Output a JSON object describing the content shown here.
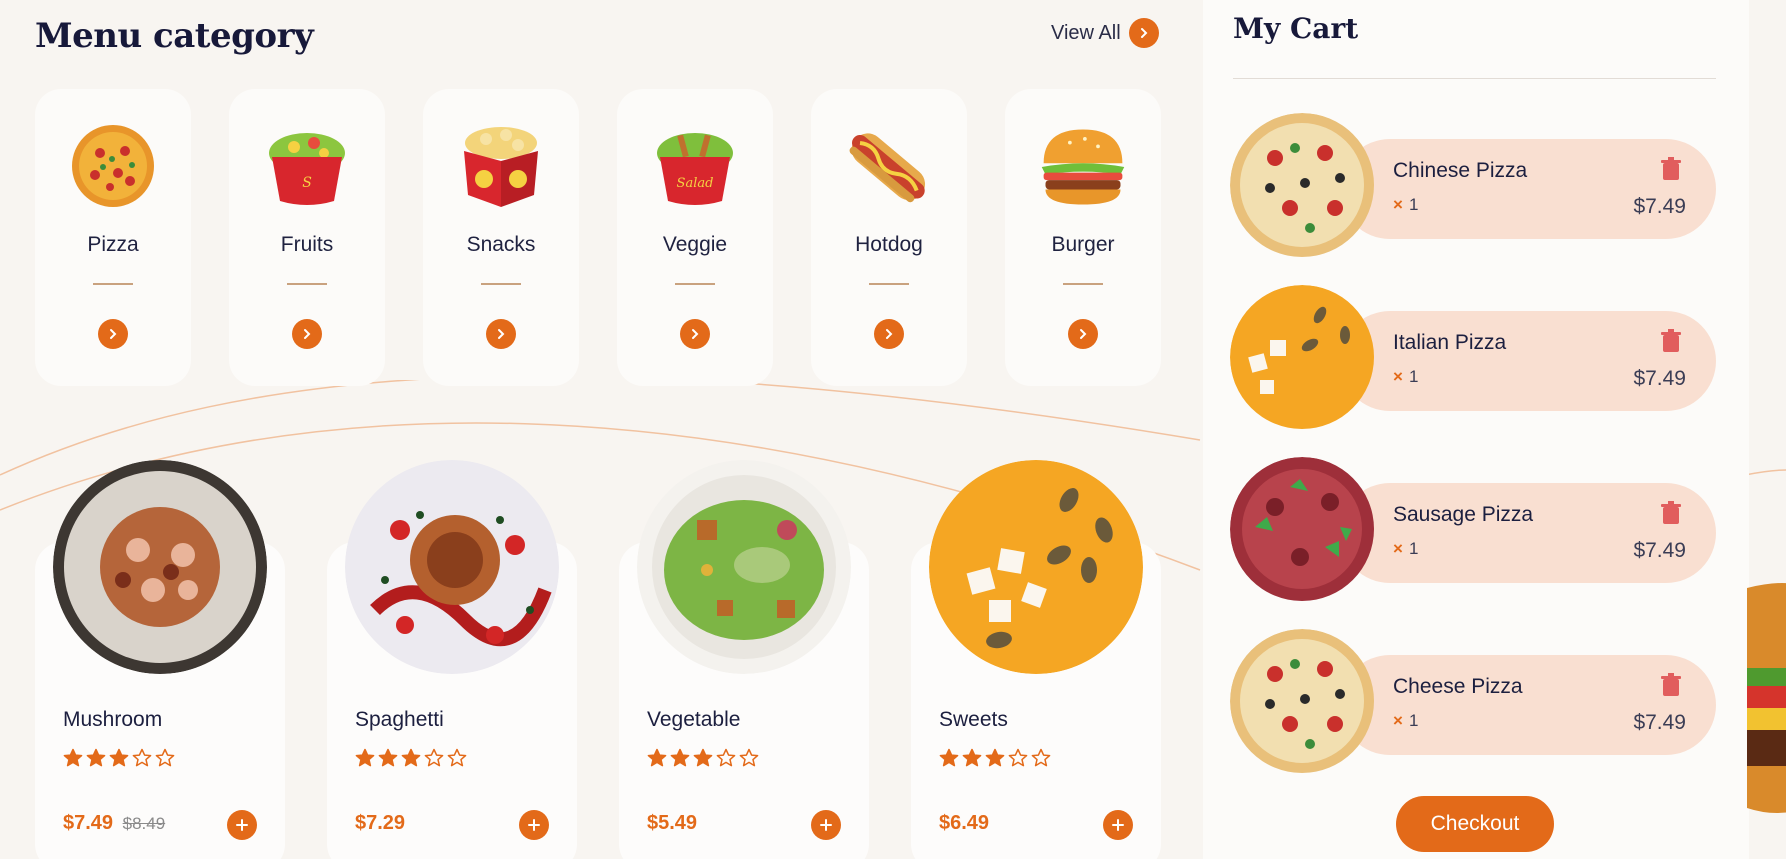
{
  "header": {
    "title": "Menu category",
    "view_all": "View All"
  },
  "categories": [
    {
      "label": "Pizza",
      "icon": "pizza-icon"
    },
    {
      "label": "Fruits",
      "icon": "fruit-bowl-icon"
    },
    {
      "label": "Snacks",
      "icon": "snacks-box-icon"
    },
    {
      "label": "Veggie",
      "icon": "salad-bowl-icon"
    },
    {
      "label": "Hotdog",
      "icon": "hotdog-icon"
    },
    {
      "label": "Burger",
      "icon": "burger-icon"
    }
  ],
  "foods": [
    {
      "name": "Mushroom",
      "rating": 3,
      "price": "$7.49",
      "old_price": "$8.49"
    },
    {
      "name": "Spaghetti",
      "rating": 3,
      "price": "$7.29",
      "old_price": ""
    },
    {
      "name": "Vegetable",
      "rating": 3,
      "price": "$5.49",
      "old_price": ""
    },
    {
      "name": "Sweets",
      "rating": 3,
      "price": "$6.49",
      "old_price": ""
    }
  ],
  "cart": {
    "title": "My Cart",
    "items": [
      {
        "name": "Chinese Pizza",
        "qty": "1",
        "price": "$7.49"
      },
      {
        "name": "Italian Pizza",
        "qty": "1",
        "price": "$7.49"
      },
      {
        "name": "Sausage Pizza",
        "qty": "1",
        "price": "$7.49"
      },
      {
        "name": "Cheese Pizza",
        "qty": "1",
        "price": "$7.49"
      }
    ],
    "checkout_label": "Checkout"
  },
  "colors": {
    "accent": "#e36a19",
    "pill": "#f9dfd1",
    "text": "#1c1f3f"
  }
}
